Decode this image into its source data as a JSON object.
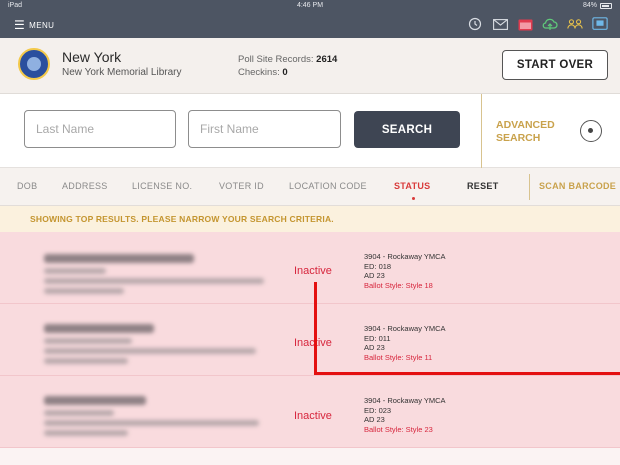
{
  "status_bar": {
    "device": "iPad",
    "time": "4:46 PM",
    "battery": "84%"
  },
  "top_bar": {
    "menu_label": "MENU",
    "icons": [
      "history-icon",
      "mail-icon",
      "calendar-icon",
      "cloud-sync-icon",
      "users-icon",
      "chat-icon"
    ]
  },
  "header": {
    "place_name": "New York",
    "place_subtitle": "New York Memorial Library",
    "records_label": "Poll Site Records:",
    "records_value": "2614",
    "checkins_label": "Checkins:",
    "checkins_value": "0",
    "start_over_label": "START OVER"
  },
  "search": {
    "last_name_placeholder": "Last Name",
    "first_name_placeholder": "First Name",
    "search_label": "SEARCH",
    "advanced_label": "ADVANCED SEARCH"
  },
  "filters": {
    "columns": [
      "DOB",
      "ADDRESS",
      "LICENSE NO.",
      "VOTER ID",
      "LOCATION CODE",
      "STATUS"
    ],
    "active": "STATUS",
    "reset_label": "RESET",
    "scan_label": "SCAN BARCODE"
  },
  "notice": "SHOWING TOP RESULTS. PLEASE NARROW YOUR SEARCH CRITERIA.",
  "results": [
    {
      "status": "Inactive",
      "site": "3904 - Rockaway YMCA",
      "ed": "ED: 018",
      "ad": "AD 23",
      "ballot_style": "Ballot Style: Style 18"
    },
    {
      "status": "Inactive",
      "site": "3904 - Rockaway YMCA",
      "ed": "ED: 011",
      "ad": "AD 23",
      "ballot_style": "Ballot Style: Style 11"
    },
    {
      "status": "Inactive",
      "site": "3904 - Rockaway YMCA",
      "ed": "ED: 023",
      "ad": "AD 23",
      "ballot_style": "Ballot Style: Style 23"
    }
  ],
  "colors": {
    "topbar": "#4d5563",
    "accent_gold": "#c9a24c",
    "inactive_red": "#d7263d",
    "row_pink": "#f9dbde",
    "annotation_red": "#e41010"
  }
}
